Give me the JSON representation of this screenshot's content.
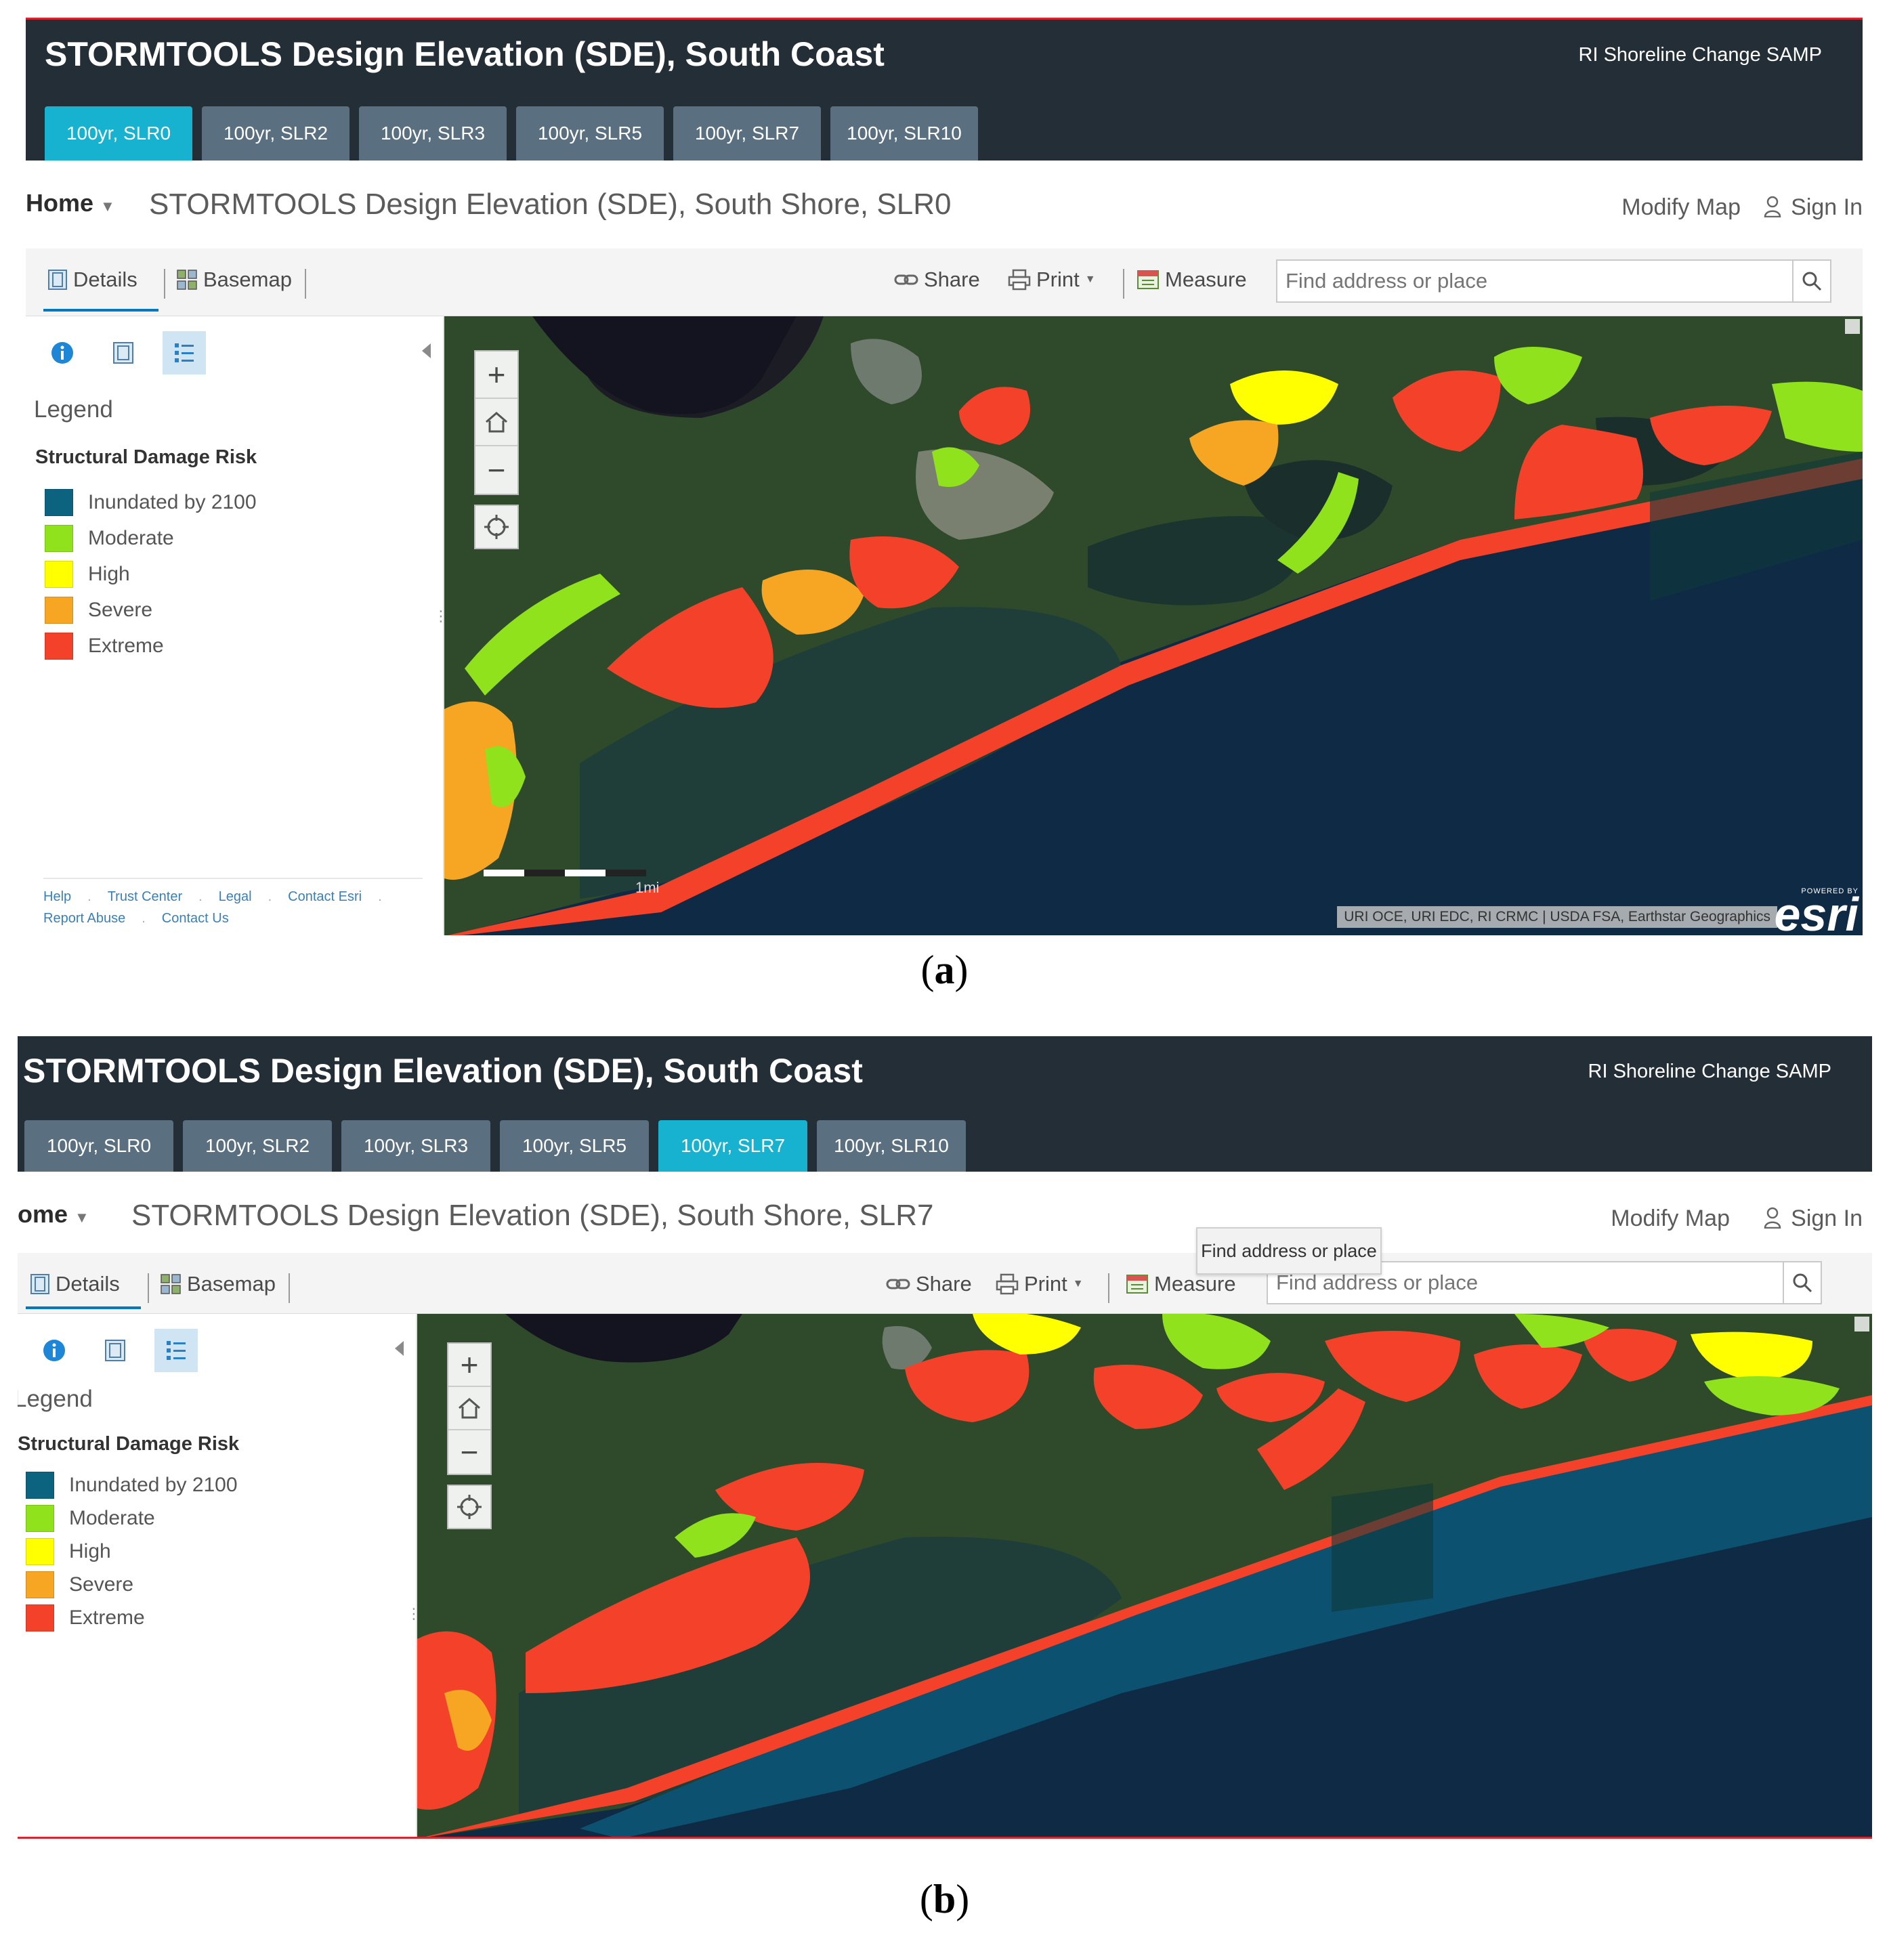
{
  "panels": [
    {
      "app_title": "STORMTOOLS Design Elevation (SDE), South Coast",
      "app_subtitle": "RI Shoreline Change SAMP",
      "tabs": [
        "100yr, SLR0",
        "100yr, SLR2",
        "100yr, SLR3",
        "100yr, SLR5",
        "100yr, SLR7",
        "100yr, SLR10"
      ],
      "active_tab": "100yr, SLR0",
      "home_label": "Home",
      "map_title": "STORMTOOLS Design Elevation (SDE), South Shore, SLR0",
      "modify_map": "Modify Map",
      "sign_in": "Sign In",
      "toolbar": {
        "details": "Details",
        "basemap": "Basemap",
        "share": "Share",
        "print": "Print",
        "measure": "Measure"
      },
      "search": {
        "placeholder": "Find address or place"
      },
      "legend": {
        "title": "Legend",
        "layer": "Structural Damage Risk",
        "items": [
          {
            "label": "Inundated by 2100",
            "color": "#0c6380"
          },
          {
            "label": "Moderate",
            "color": "#8fe21c"
          },
          {
            "label": "High",
            "color": "#ffff00"
          },
          {
            "label": "Severe",
            "color": "#f6a623"
          },
          {
            "label": "Extreme",
            "color": "#f4422a"
          }
        ]
      },
      "footer_links": [
        "Help",
        "Trust Center",
        "Legal",
        "Contact Esri",
        "Report Abuse",
        "Contact Us"
      ],
      "scale_label": "1mi",
      "attribution": "URI OCE, URI EDC, RI CRMC | USDA FSA, Earthstar Geographics",
      "esri_powered": "POWERED BY",
      "esri_logo": "esri",
      "caption": "a"
    },
    {
      "app_title": "STORMTOOLS Design Elevation (SDE), South Coast",
      "app_subtitle": "RI Shoreline Change SAMP",
      "tabs": [
        "100yr, SLR0",
        "100yr, SLR2",
        "100yr, SLR3",
        "100yr, SLR5",
        "100yr, SLR7",
        "100yr, SLR10"
      ],
      "active_tab": "100yr, SLR7",
      "home_label": "Home",
      "map_title": "STORMTOOLS Design Elevation (SDE), South Shore, SLR7",
      "modify_map": "Modify Map",
      "sign_in": "Sign In",
      "toolbar": {
        "details": "Details",
        "basemap": "Basemap",
        "share": "Share",
        "print": "Print",
        "measure": "Measure"
      },
      "search": {
        "placeholder": "Find address or place"
      },
      "tooltip": "Find address or place",
      "legend": {
        "title": "Legend",
        "layer": "Structural Damage Risk",
        "items": [
          {
            "label": "Inundated by 2100",
            "color": "#0c6380"
          },
          {
            "label": "Moderate",
            "color": "#8fe21c"
          },
          {
            "label": "High",
            "color": "#ffff00"
          },
          {
            "label": "Severe",
            "color": "#f6a623"
          },
          {
            "label": "Extreme",
            "color": "#f4422a"
          }
        ]
      },
      "caption": "b"
    }
  ],
  "colors": {
    "header_bg": "#242e36",
    "tab_bg": "#5a6f80",
    "tab_active": "#17b2d0",
    "accent_red": "#d7262f",
    "ocean": "#0e2740"
  }
}
